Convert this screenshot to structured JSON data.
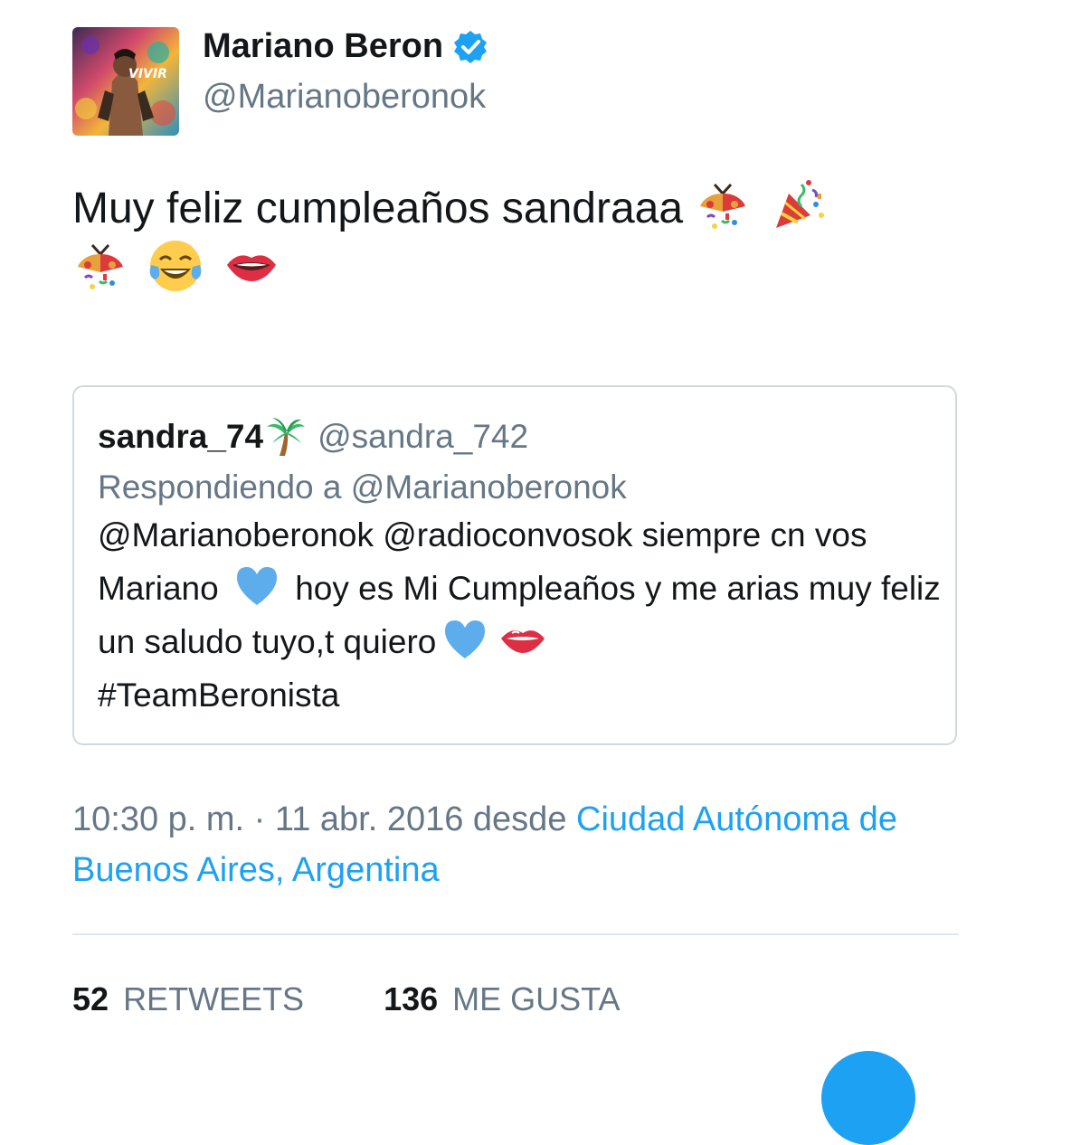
{
  "colors": {
    "link": "#1da1f2",
    "muted": "#657786",
    "text": "#14171a",
    "border": "#cfd9de",
    "verified": "#1da1f2"
  },
  "author": {
    "display_name": "Mariano Beron",
    "handle": "@Marianoberonok",
    "verified_icon": "verified-badge-icon",
    "avatar_text": "VIVIR"
  },
  "tweet": {
    "text_line1": "Muy feliz cumpleaños sandraaa",
    "emojis_line1": [
      "confetti-ball-icon",
      "party-popper-icon"
    ],
    "emojis_line2": [
      "confetti-ball-icon",
      "tears-of-joy-icon",
      "lips-icon"
    ]
  },
  "quoted": {
    "name": "sandra_74",
    "name_emoji": "palm-tree-icon",
    "handle": "@sandra_742",
    "replying_to": "Respondiendo a @Marianoberonok",
    "body_part1": "@Marianoberonok @radioconvosok  siempre cn vos Mariano ",
    "body_part2": " hoy es Mi Cumpleaños y me arias muy feliz un saludo tuyo,t quiero",
    "body_part3": "#TeamBeronista",
    "body_emojis": [
      "blue-heart-icon",
      "blue-heart-icon",
      "kiss-mark-icon"
    ]
  },
  "meta": {
    "time": "10:30 p. m. · 11 abr. 2016 desde ",
    "location": "Ciudad Autónoma de Buenos Aires, Argentina"
  },
  "stats": {
    "retweets_count": "52",
    "retweets_label": "RETWEETS",
    "likes_count": "136",
    "likes_label": "ME GUSTA"
  }
}
